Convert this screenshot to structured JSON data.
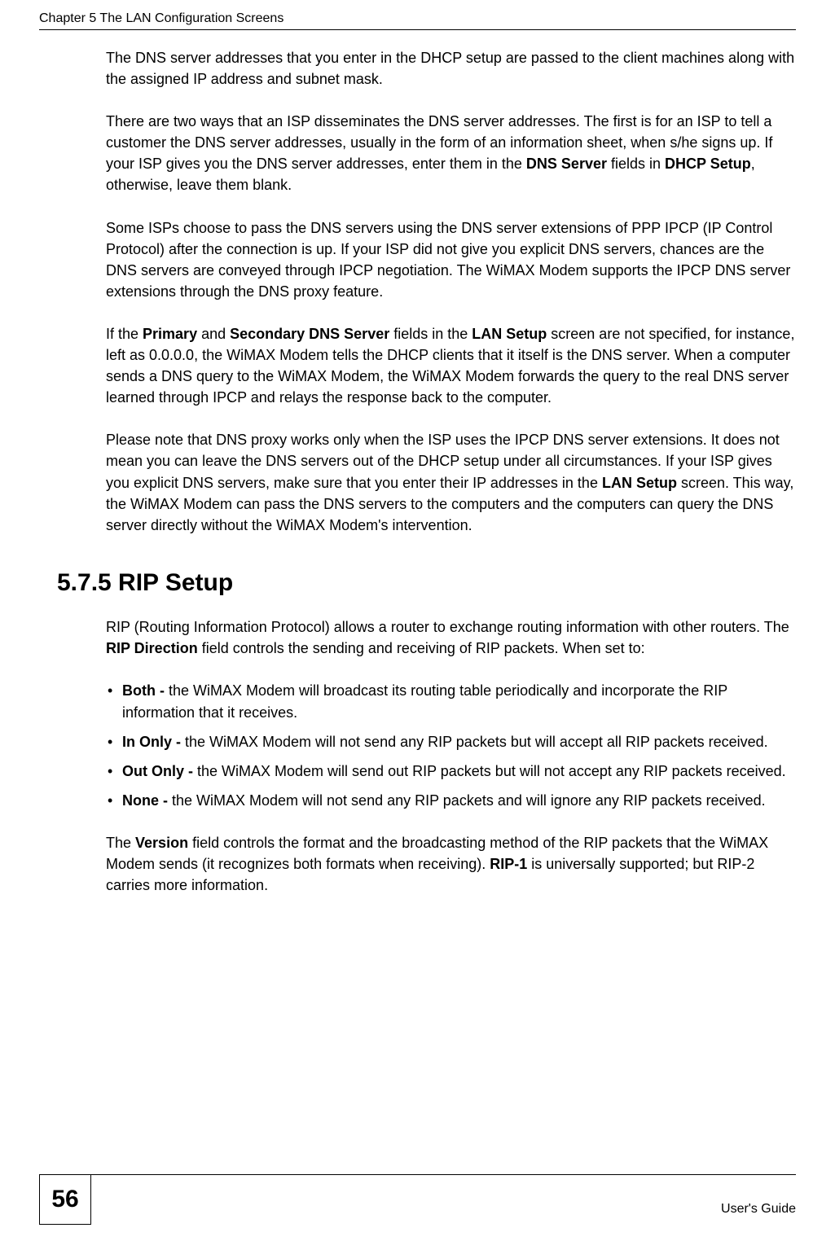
{
  "header": {
    "chapter_title": "Chapter 5 The LAN Configuration Screens"
  },
  "body": {
    "para1_a": "The DNS server addresses that you enter in the DHCP setup are passed to the client machines along with the assigned IP address and subnet mask.",
    "para2_a": "There are two ways that an ISP disseminates the DNS server addresses. The first is for an ISP to tell a customer the DNS server addresses, usually in the form of an information sheet, when s/he signs up. If your ISP gives you the DNS server addresses, enter them in the ",
    "para2_b": "DNS Server",
    "para2_c": " fields in ",
    "para2_d": "DHCP Setup",
    "para2_e": ", otherwise, leave them blank.",
    "para3": "Some ISPs choose to pass the DNS servers using the DNS server extensions of PPP IPCP (IP Control Protocol) after the connection is up. If your ISP did not give you explicit DNS servers, chances are the DNS servers are conveyed through IPCP negotiation. The WiMAX Modem supports the IPCP DNS server extensions through the DNS proxy feature.",
    "para4_a": "If the ",
    "para4_b": "Primary",
    "para4_c": " and ",
    "para4_d": "Secondary DNS Server",
    "para4_e": " fields in the ",
    "para4_f": "LAN Setup",
    "para4_g": " screen are not specified, for instance, left as 0.0.0.0, the WiMAX Modem tells the DHCP clients that it itself is the DNS server. When a computer sends a DNS query to the WiMAX Modem, the WiMAX Modem forwards the query to the real DNS server learned through IPCP and relays the response back to the computer.",
    "para5_a": "Please note that DNS proxy works only when the ISP uses the IPCP DNS server extensions. It does not mean you can leave the DNS servers out of the DHCP setup under all circumstances. If your ISP gives you explicit DNS servers, make sure that you enter their IP addresses in the ",
    "para5_b": "LAN Setup",
    "para5_c": " screen. This way, the WiMAX Modem can pass the DNS servers to the computers and the computers can query the DNS server directly without the WiMAX Modem's intervention.",
    "section_heading": "5.7.5  RIP Setup",
    "para6_a": "RIP (Routing Information Protocol) allows a router to exchange routing information with other routers. The ",
    "para6_b": "RIP Direction",
    "para6_c": " field controls the sending and receiving of RIP packets.  When set to:",
    "bullets": {
      "b1_label": "Both -",
      "b1_text": " the WiMAX Modem will broadcast its routing table periodically and incorporate the RIP information that it receives.",
      "b2_label": "In Only -",
      "b2_text": " the WiMAX Modem will not send any RIP packets but will accept all RIP packets received.",
      "b3_label": "Out Only -",
      "b3_text": " the WiMAX Modem will send out RIP packets but will not accept any RIP packets received.",
      "b4_label": "None -",
      "b4_text": " the WiMAX Modem will not send any RIP packets and will ignore any RIP packets received."
    },
    "para7_a": "The ",
    "para7_b": "Version",
    "para7_c": " field controls the format and the broadcasting method of the RIP packets that the WiMAX Modem sends (it recognizes both formats when receiving). ",
    "para7_d": "RIP-1",
    "para7_e": " is universally supported; but RIP-2 carries more information. "
  },
  "footer": {
    "page_number": "56",
    "guide_label": "User's Guide"
  }
}
